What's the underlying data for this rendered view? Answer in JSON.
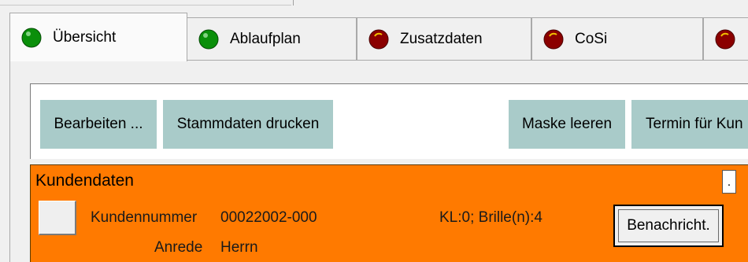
{
  "tabs": [
    {
      "label": "Übersicht",
      "status": "green",
      "active": true
    },
    {
      "label": "Ablaufplan",
      "status": "green",
      "active": false
    },
    {
      "label": "Zusatzdaten",
      "status": "red",
      "active": false
    },
    {
      "label": "CoSi",
      "status": "red",
      "active": false
    },
    {
      "label": "",
      "status": "red",
      "active": false
    }
  ],
  "colors": {
    "status_green": "#0a8f0a",
    "status_red": "#8b0000",
    "toolbar_button": "#a9cbc9",
    "kunden_panel": "#ff7a00"
  },
  "toolbar": {
    "buttons": [
      {
        "label": "Bearbeiten ..."
      },
      {
        "label": "Stammdaten drucken"
      },
      {
        "label": "Maske leeren"
      },
      {
        "label": "Termin für Kun"
      }
    ]
  },
  "kundendaten": {
    "title": "Kundendaten",
    "dot_button_label": ".",
    "kundennummer_label": "Kundennummer",
    "kundennummer_value": "00022002-000",
    "anrede_label": "Anrede",
    "anrede_value": "Herrn",
    "kl_info": "KL:0; Brille(n):4",
    "benachricht_label": "Benachricht."
  }
}
